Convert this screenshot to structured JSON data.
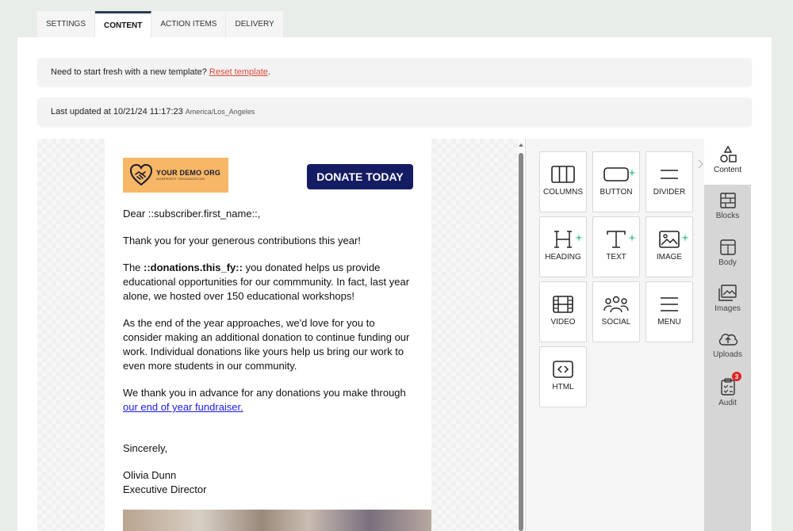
{
  "tabs": [
    {
      "label": "SETTINGS",
      "active": false
    },
    {
      "label": "CONTENT",
      "active": true
    },
    {
      "label": "ACTION ITEMS",
      "active": false
    },
    {
      "label": "DELIVERY",
      "active": false
    }
  ],
  "notice": {
    "reset_prompt": "Need to start fresh with a new template?",
    "reset_link": "Reset template",
    "reset_suffix": ".",
    "updated_label": "Last updated at 10/21/24 11:17:23",
    "timezone": "America/Los_Angeles"
  },
  "email": {
    "logo_name": "YOUR DEMO ORG",
    "logo_sub": "NONPROFIT ORGANIZATION",
    "donate_label": "DONATE TODAY",
    "greeting": "Dear ::subscriber.first_name::,",
    "thanks": "Thank you for your generous contributions this year!",
    "para1_pre": "The ",
    "para1_token": "::donations.this_fy::",
    "para1_post": " you donated helps us provide educational opportunities for our commmunity. In fact, last year alone, we hosted over 150 educational workshops!",
    "para2": "As the end of the year approaches, we'd love for you to consider making an additional donation to continue funding our work. Individual donations like yours help us bring our work to even more students in our community.",
    "para3_pre": "We thank you in advance for any donations you make through ",
    "para3_link": "our end of year fundraiser.",
    "closing": "Sincerely,",
    "signer_name": "Olivia Dunn",
    "signer_title": "Executive Director"
  },
  "tools": [
    {
      "label": "COLUMNS",
      "icon": "columns-icon",
      "sparkle": false
    },
    {
      "label": "BUTTON",
      "icon": "button-icon",
      "sparkle": true
    },
    {
      "label": "DIVIDER",
      "icon": "divider-icon",
      "sparkle": false
    },
    {
      "label": "HEADING",
      "icon": "heading-icon",
      "sparkle": true
    },
    {
      "label": "TEXT",
      "icon": "text-icon",
      "sparkle": true
    },
    {
      "label": "IMAGE",
      "icon": "image-icon",
      "sparkle": true
    },
    {
      "label": "VIDEO",
      "icon": "video-icon",
      "sparkle": false
    },
    {
      "label": "SOCIAL",
      "icon": "social-icon",
      "sparkle": false
    },
    {
      "label": "MENU",
      "icon": "menu-icon",
      "sparkle": false
    },
    {
      "label": "HTML",
      "icon": "html-icon",
      "sparkle": false
    }
  ],
  "sidebar": {
    "items": [
      {
        "label": "Content",
        "icon": "shapes-icon",
        "active": true
      },
      {
        "label": "Blocks",
        "icon": "blocks-icon",
        "active": false
      },
      {
        "label": "Body",
        "icon": "body-layout-icon",
        "active": false
      },
      {
        "label": "Images",
        "icon": "images-icon",
        "active": false
      },
      {
        "label": "Uploads",
        "icon": "cloud-upload-icon",
        "active": false
      },
      {
        "label": "Audit",
        "icon": "clipboard-check-icon",
        "active": false,
        "badge": "3"
      }
    ]
  },
  "colors": {
    "accent_tab": "#2c3e50",
    "reset_link": "#d94a3a",
    "logo_bg": "#f7b766",
    "donate_bg": "#141c63",
    "sparkle": "#5cc8a8",
    "badge": "#e02424"
  }
}
